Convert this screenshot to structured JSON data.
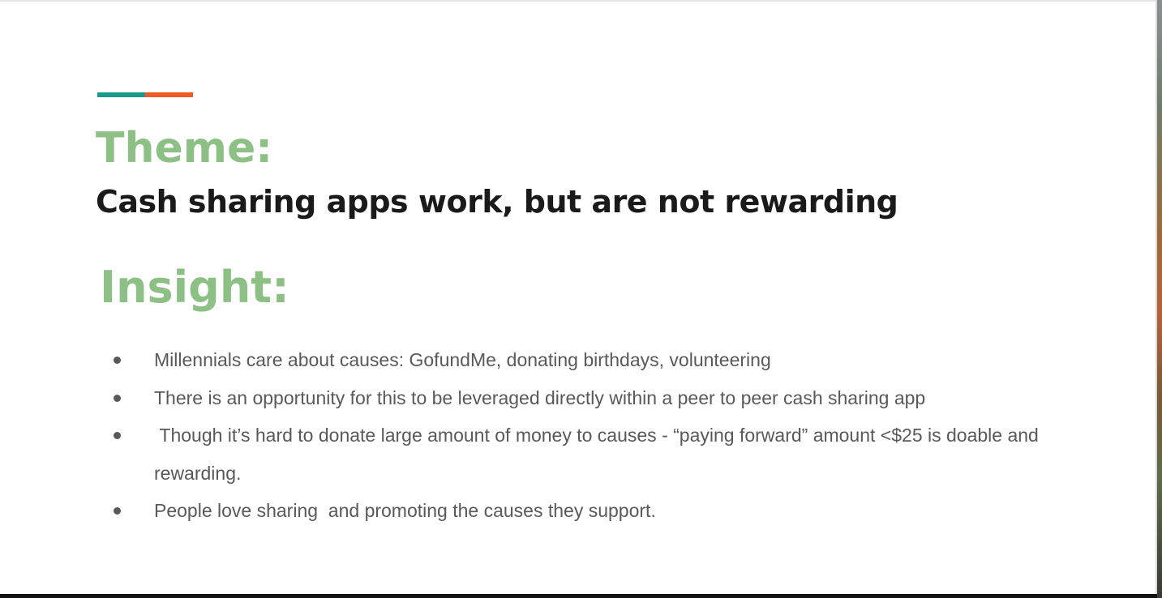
{
  "colors": {
    "heading_green": "#8cc084",
    "accent_teal": "#1a9a8a",
    "accent_orange": "#f05a28",
    "body_text": "#595959",
    "statement_text": "#1a1a1a"
  },
  "slide": {
    "theme_heading": "Theme:",
    "theme_statement": "Cash sharing apps work, but are not rewarding",
    "insight_heading": "Insight:",
    "bullets": [
      {
        "text": "Millennials care about causes: GofundMe, donating birthdays, volunteering"
      },
      {
        "text": "There is an opportunity for this to be leveraged directly within a peer to peer cash sharing app"
      },
      {
        "text": " Though it’s hard to donate large amount of money to causes - “paying forward” amount <$25 is doable and rewarding."
      },
      {
        "text": "People love sharing  and promoting the causes they support."
      }
    ]
  }
}
